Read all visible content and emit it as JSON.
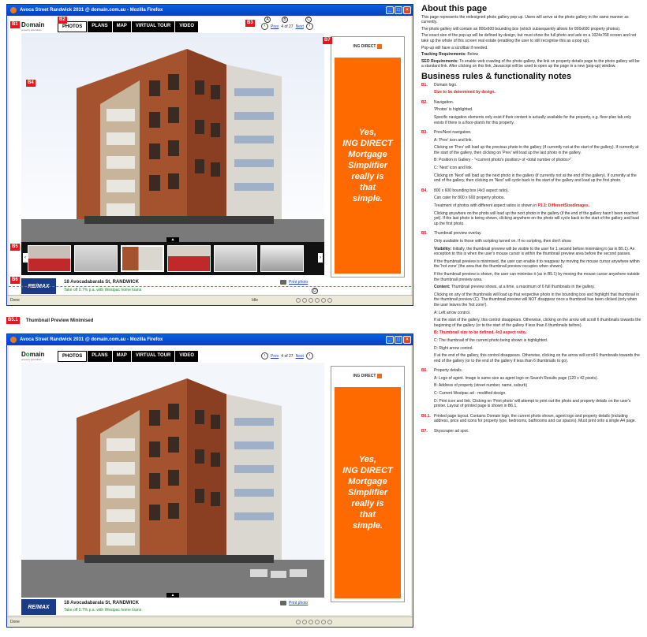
{
  "browser_title": "Avoca Street Randwick 2031 @ domain.com.au - Mozilla Firefox",
  "browser_title_2": "Avoca Street Randwick 2031 @ domain.com.au - Mozilla Firefox",
  "status_done": "Done",
  "status_idle": "Idle",
  "logo": {
    "text_a": "D",
    "text_o": "o",
    "text_rest": "main",
    "tagline": "property specialists"
  },
  "nav": [
    "PHOTOS",
    "PLANS",
    "MAP",
    "VIRTUAL TOUR",
    "VIDEO"
  ],
  "prevnext": {
    "prev": "Prev",
    "position": "4 of 27",
    "next": "Next"
  },
  "ad": {
    "brand": "ING DIRECT",
    "line1": "Yes,",
    "line2": "ING DIRECT",
    "line3": "Mortgage",
    "line4": "Simplifier",
    "line5": "really is",
    "line6": "that",
    "line7": "simple."
  },
  "property": {
    "agent": "RE/MAX",
    "address": "18 Avocadabarala St, RANDWICK",
    "westpac": "Take off 0.7% p.a. with Westpac home loans",
    "print": "Print photo"
  },
  "markers": {
    "b1": "B1",
    "b2": "B2",
    "b3": "B3",
    "b4": "B4",
    "b5": "B5",
    "b6": "B6",
    "b7": "B7",
    "b51": "B5.1"
  },
  "circle_labels": {
    "a": "A",
    "b": "B",
    "c": "C",
    "d": "D"
  },
  "caption": "Thumbnail Preview Minimised",
  "notes": {
    "title": "About this page",
    "intro1": "This page represents the redesigned photo gallery pop-up. Users will arrive at the photo gallery in the same manner as currently.",
    "intro2": "The photo gallery will contain an 800x600 bounding box (which subsequently allows for 800x600 property photos).",
    "intro3": "The exact size of the pop-up will be defined by design, but must show the full photo and ads on a 1024x768 screen and not take up the whole of this screen real estate (enabling the user to still recognise this as a pop up).",
    "intro4": "Pop-up will have a scrollbar if needed.",
    "tracking_label": "Tracking Requirements:",
    "tracking": "Below",
    "seo_label": "SEO Requirements:",
    "seo": "To enable web crawling of the photo gallery, the link on property details page to the photo gallery will be a standard link. After clicking on this link, Javascript will be used to open up the page in a new (pop-up) window.",
    "rules_title": "Business rules & functionality notes",
    "b1_text": "Domain logo.",
    "b1_red": "Size to be determined by design.",
    "b2_text": "Navigation.",
    "b2_p1": "'Photos' is highlighted.",
    "b2_p2": "Specific navigation elements only exist if their content is actually available for the property, e.g. floor-plan tab only exists if there is a floor-plan/s for this property.",
    "b3_text": "Prev/Next navigation.",
    "b3_a": "A: 'Prev' icon and link.",
    "b3_a_p": "Clicking on 'Prev' will load up the previous photo in the gallery (if currently not at the start of the gallery). If currently at the start of the gallery, then clicking on 'Prev' will load up the last photo in the gallery.",
    "b3_b": "B: Position in Gallery - \"<current photo's position> of <total number of photos>\"",
    "b3_c": "C: 'Next' icon and link.",
    "b3_c_p": "Clicking on 'Next' will load up the next photo in the gallery (if currently not at the end of the gallery). If currently at the end of the gallery, then clicking on 'Next' will cycle back to the start of the gallery and load up the first photo.",
    "b4_text": "800 x 600 bounding box (4x3 aspect ratio).",
    "b4_p1": "Can cater for 800 x 600 property photos.",
    "b4_p2a": "Treatment of photos with different aspect ratios is shown in",
    "b4_p2red": "P1.1: DifferentSizedImages.",
    "b4_p3": "Clicking anywhere on the photo will load up the next photo in the gallery (if the end of the gallery hasn't been reached yet). If the last photo is being shown, clicking anywhere on the photo will cycle back to the start of the gallery and load up the first photo.",
    "b5_text": "Thumbnail preview overlay.",
    "b5_p1": "Only available to those with scripting turned on. If no scripting, then don't show.",
    "b5_vis_label": "Visibility:",
    "b5_vis": "Initially, the thumbnail preview will be visible to the user for 1 second before minimising it (as in B5.1). An exception to this is when the user's mouse cursor is within the thumbnail preview area before the second passes.",
    "b5_p3": "If the thumbnail preview is minimised, the user can enable it to reappear by moving the mouse cursor anywhere within the 'hot zone' (the area that the thumbnail preview occupies when shown).",
    "b5_p4": "If the thumbnail preview is shown, the user can minimise it (as in B5.1) by moving the mouse cursor anywhere outside the thumbnail preview area.",
    "b5_content_label": "Content:",
    "b5_content": "Thumbnail preview shows, at a time, a maximum of 6 full thumbnails in the gallery.",
    "b5_p6": "Clicking on any of the thumbnails will load up that respective photo in the bounding box and highlight that thumbnail in the thumbnail preview (C). The thumbnail preview will NOT disappear once a thumbnail has been clicked (only when the user leaves the 'hot zone').",
    "b5_a": "A: Left arrow control.",
    "b5_a_p": "If at the start of the gallery, this control disappears. Otherwise, clicking on the arrow will scroll 6 thumbnails towards the beginning of the gallery (or to the start of the gallery if less than 6 thumbnails before).",
    "b5_b_red": "B: Thumbnail size to be defined. 4x3 aspect ratio.",
    "b5_c": "C: The thumbnail of the current photo being shown is highlighted.",
    "b5_d": "D: Right arrow control.",
    "b5_d_p": "If at the end of the gallery, this control disappears. Otherwise, clicking on the arrow will scroll 6 thumbnails towards the end of the gallery (or to the end of the gallery if less than 6 thumbnails to go).",
    "b6_text": "Property details.",
    "b6_a": "A: Logo of agent. Image is same size as agent logo on Search Results page (120 x 42 pixels).",
    "b6_b": "B: Address of property (street number, name, suburb)",
    "b6_c": "C: Current Westpac ad - modified design.",
    "b6_d": "D: Print icon and link. Clicking on 'Print photo' will attempt to print out the photo and property details on the user's printer. Layout of printed page is shown in B6.1.",
    "b61_text": "Printed page layout. Contains Domain logo, the current photo shown, agent logo and property details (including address, price and icons for property type, bedrooms, bathrooms and car spaces). Must print onto a single A4 page.",
    "b7_text": "Skyscraper ad spot."
  },
  "rule_codes": [
    "B1.",
    "B2.",
    "B3.",
    "B4.",
    "B5.",
    "B6.",
    "B6.1.",
    "B7."
  ]
}
